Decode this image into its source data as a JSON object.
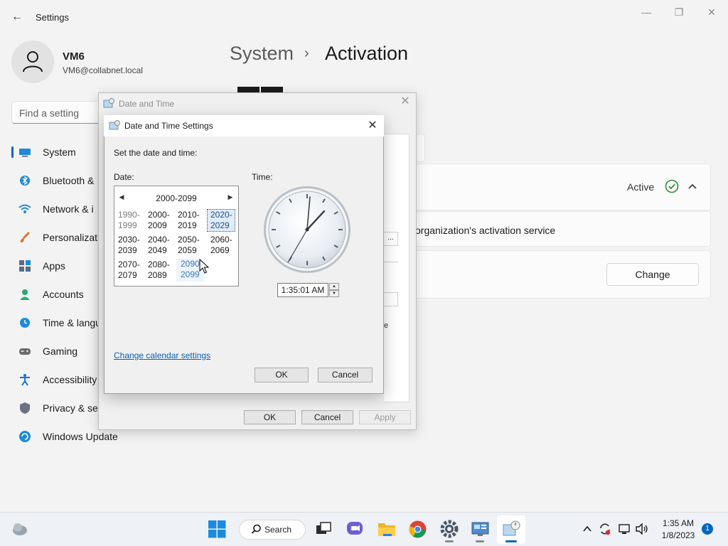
{
  "window": {
    "title": "Settings"
  },
  "user": {
    "name": "VM6",
    "email": "VM6@collabnet.local"
  },
  "search": {
    "placeholder": "Find a setting"
  },
  "nav": {
    "items": [
      {
        "label": "System"
      },
      {
        "label": "Bluetooth &"
      },
      {
        "label": "Network & i"
      },
      {
        "label": "Personalizati"
      },
      {
        "label": "Apps"
      },
      {
        "label": "Accounts"
      },
      {
        "label": "Time & langu"
      },
      {
        "label": "Gaming"
      },
      {
        "label": "Accessibility"
      },
      {
        "label": "Privacy & se"
      },
      {
        "label": "Windows Update"
      }
    ]
  },
  "breadcrumb": {
    "parent": "System",
    "separator": "›",
    "current": "Activation"
  },
  "activation": {
    "status": "Active",
    "org_text": "organization's activation service",
    "change_label": "Change",
    "ellipsis": "...",
    "partial_e": "e"
  },
  "date_time_dialog": {
    "title": "Date and Time",
    "ok_label": "OK",
    "cancel_label": "Cancel",
    "apply_label": "Apply"
  },
  "settings_dialog": {
    "title": "Date and Time Settings",
    "instruction": "Set the date and time:",
    "date_label": "Date:",
    "time_label": "Time:",
    "calendar": {
      "range": "2000-2099",
      "prev": "◀",
      "next": "▶",
      "decades": [
        {
          "top": "1990-",
          "bottom": "1999"
        },
        {
          "top": "2000-",
          "bottom": "2009"
        },
        {
          "top": "2010-",
          "bottom": "2019"
        },
        {
          "top": "2020-",
          "bottom": "2029"
        },
        {
          "top": "2030-",
          "bottom": "2039"
        },
        {
          "top": "2040-",
          "bottom": "2049"
        },
        {
          "top": "2050-",
          "bottom": "2059"
        },
        {
          "top": "2060-",
          "bottom": "2069"
        },
        {
          "top": "2070-",
          "bottom": "2079"
        },
        {
          "top": "2080-",
          "bottom": "2089"
        },
        {
          "top": "2090-",
          "bottom": "2099"
        }
      ]
    },
    "time_value": "1:35:01 AM",
    "change_calendar_link": "Change calendar settings",
    "ok_label": "OK",
    "cancel_label": "Cancel"
  },
  "taskbar": {
    "search_label": "Search",
    "time": "1:35 AM",
    "date": "1/8/2023",
    "notification_count": "1"
  },
  "colors": {
    "accent": "#0067c0",
    "active_check": "#2e8b3a",
    "link": "#0a5fb4"
  }
}
